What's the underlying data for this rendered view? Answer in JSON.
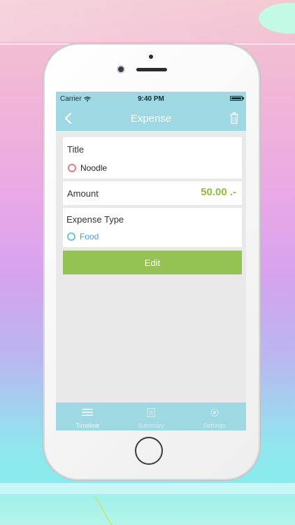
{
  "status_bar": {
    "carrier": "Carrier",
    "time": "9:40 PM"
  },
  "nav": {
    "title": "Expense",
    "back_icon": "chevron-left-icon",
    "trash_icon": "trash-icon"
  },
  "title_section": {
    "label": "Title",
    "value": "Noodle"
  },
  "amount_section": {
    "label": "Amount",
    "value": "50.00 .-"
  },
  "type_section": {
    "label": "Expense Type",
    "value": "Food"
  },
  "edit_button": {
    "label": "Edit"
  },
  "tabs": [
    {
      "label": "Timeline",
      "icon": "list-icon"
    },
    {
      "label": "Summary",
      "icon": "document-icon"
    },
    {
      "label": "Settings",
      "icon": "gear-icon"
    }
  ],
  "colors": {
    "nav_bar": "#9dd8e3",
    "edit_button": "#94c353",
    "amount_text": "#8cbf3d",
    "title_marker": "#e27b7e",
    "type_marker": "#6cc6d5",
    "type_text": "#4a9fc3"
  }
}
